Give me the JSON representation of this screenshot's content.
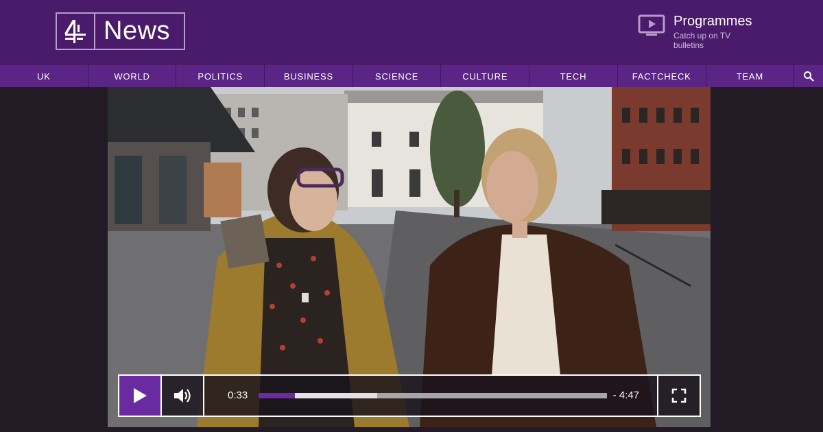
{
  "brand": {
    "logo_text": "News",
    "accent": "#4a1a6b",
    "nav_bg": "#5a2585",
    "player_accent": "#6a2aa0"
  },
  "header": {
    "programmes_title": "Programmes",
    "programmes_sub": "Catch up on TV bulletins",
    "programmes_icon": "tv-play-icon"
  },
  "nav": {
    "items": [
      {
        "label": "UK"
      },
      {
        "label": "WORLD"
      },
      {
        "label": "POLITICS"
      },
      {
        "label": "BUSINESS"
      },
      {
        "label": "SCIENCE"
      },
      {
        "label": "CULTURE"
      },
      {
        "label": "TECH"
      },
      {
        "label": "FACTCHECK"
      },
      {
        "label": "TEAM"
      }
    ],
    "search_icon": "search-icon"
  },
  "player": {
    "current_time": "0:33",
    "remaining_time": "- 4:47",
    "progress_fraction": 0.105,
    "buffered_fraction": 0.34,
    "icons": {
      "play": "play-icon",
      "volume": "volume-icon",
      "fullscreen": "fullscreen-icon"
    }
  }
}
